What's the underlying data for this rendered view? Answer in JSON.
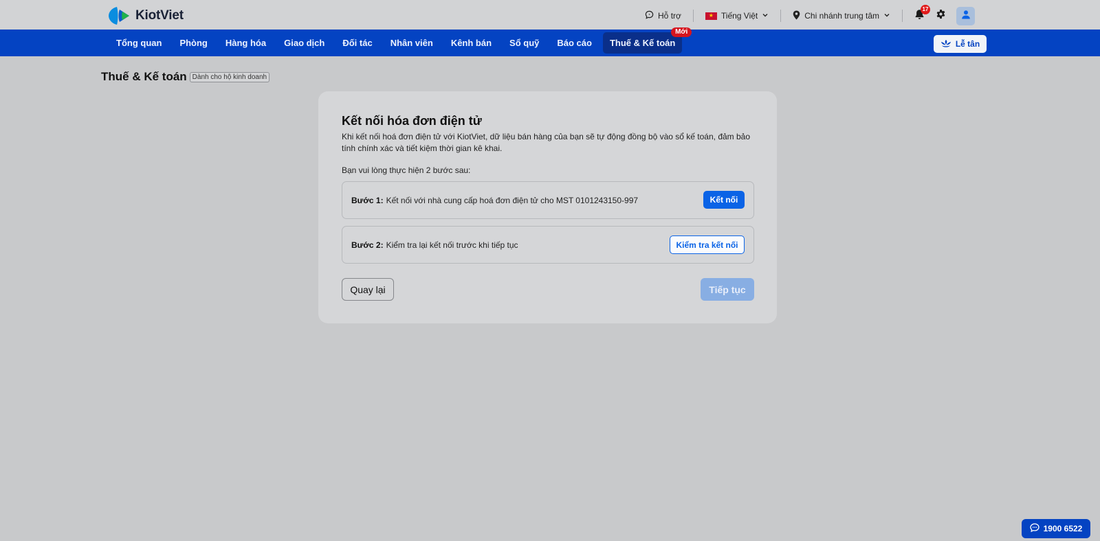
{
  "brand": {
    "name": "KiotViet"
  },
  "header": {
    "support_label": "Hỗ trợ",
    "language_label": "Tiếng Việt",
    "branch_label": "Chi nhánh trung tâm",
    "notification_count": "17"
  },
  "nav": {
    "items": [
      {
        "label": "Tổng quan"
      },
      {
        "label": "Phòng"
      },
      {
        "label": "Hàng hóa"
      },
      {
        "label": "Giao dịch"
      },
      {
        "label": "Đối tác"
      },
      {
        "label": "Nhân viên"
      },
      {
        "label": "Kênh bán"
      },
      {
        "label": "Sổ quỹ"
      },
      {
        "label": "Báo cáo"
      },
      {
        "label": "Thuế & Kế toán",
        "badge": "Mới",
        "active": true
      }
    ],
    "reception_label": "Lễ tân"
  },
  "page": {
    "title": "Thuế & Kế toán",
    "tag": "Dành cho hộ kinh doanh"
  },
  "card": {
    "title": "Kết nối hóa đơn điện tử",
    "description": "Khi kết nối hoá đơn điện tử với KiotViet, dữ liệu bán hàng của bạn sẽ tự động đồng bộ vào sổ kế toán, đảm bảo tính chính xác và tiết kiệm thời gian kê khai.",
    "instruction": "Bạn vui lòng thực hiện 2 bước sau:",
    "step1": {
      "prefix": "Bước 1:",
      "text": "Kết nối với nhà cung cấp hoá đơn điện tử cho MST 0101243150-997",
      "button": "Kết nối"
    },
    "step2": {
      "prefix": "Bước 2:",
      "text": "Kiểm tra lại kết nối trước khi tiếp tục",
      "button": "Kiểm tra kết nối"
    },
    "back_label": "Quay lại",
    "next_label": "Tiếp tục"
  },
  "hotline": {
    "number": "1900 6522"
  },
  "colors": {
    "nav_blue": "#0443c2",
    "primary": "#0a63e6",
    "badge_red": "#d6141e"
  }
}
